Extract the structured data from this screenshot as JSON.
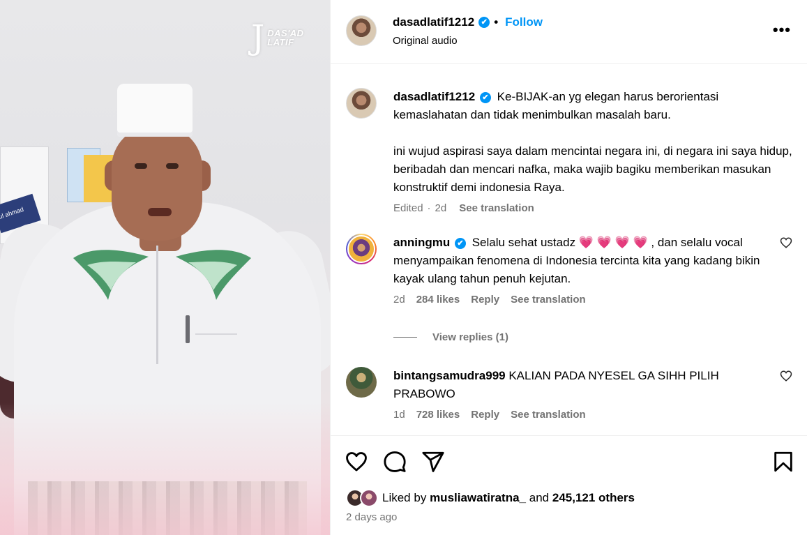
{
  "video": {
    "watermark_mark": "J",
    "watermark_line1": "DAS'AD",
    "watermark_line2": "LATIF",
    "nameplate_text": "ul ahmad"
  },
  "header": {
    "username": "dasadlatif1212",
    "verified_glyph": "✔",
    "separator": "•",
    "follow_label": "Follow",
    "audio_label": "Original audio",
    "more_label": "•••"
  },
  "caption": {
    "username": "dasadlatif1212",
    "paragraph1": "Ke-BIJAK-an yg elegan harus berorientasi kemaslahatan dan tidak menimbulkan masalah baru.",
    "paragraph2": "ini wujud aspirasi saya dalam mencintai negara ini, di negara ini saya hidup, beribadah dan mencari nafka, maka wajib bagiku memberikan masukan konstruktif demi indonesia Raya.",
    "edited": "Edited",
    "dot": "·",
    "time": "2d",
    "see_translation": "See translation"
  },
  "comments": [
    {
      "username": "anningmu",
      "text_before": "Selalu sehat ustadz",
      "emojis": "💗 💗 💗 💗",
      "text_after": ", dan selalu vocal menyampaikan fenomena di Indonesia tercinta kita yang kadang bikin kayak ulang tahun penuh kejutan.",
      "time": "2d",
      "likes": "284 likes",
      "reply": "Reply",
      "see_translation": "See translation"
    },
    {
      "username": "bintangsamudra999",
      "text": "KALIAN PADA NYESEL GA SIHH PILIH PRABOWO",
      "time": "1d",
      "likes": "728 likes",
      "reply": "Reply",
      "see_translation": "See translation"
    }
  ],
  "view_replies": "View replies (1)",
  "likes": {
    "prefix": "Liked by",
    "user": "musliawatiratna_",
    "middle": "and",
    "count": "245,121 others"
  },
  "post_date": "2 days ago",
  "icons": {
    "like": "heart-icon",
    "comment": "comment-icon",
    "share": "share-icon",
    "save": "bookmark-icon",
    "verified": "verified-badge-icon",
    "more": "more-options-icon"
  },
  "colors": {
    "accent": "#0095f6",
    "secondary_text": "#737373",
    "divider": "#efefef"
  }
}
